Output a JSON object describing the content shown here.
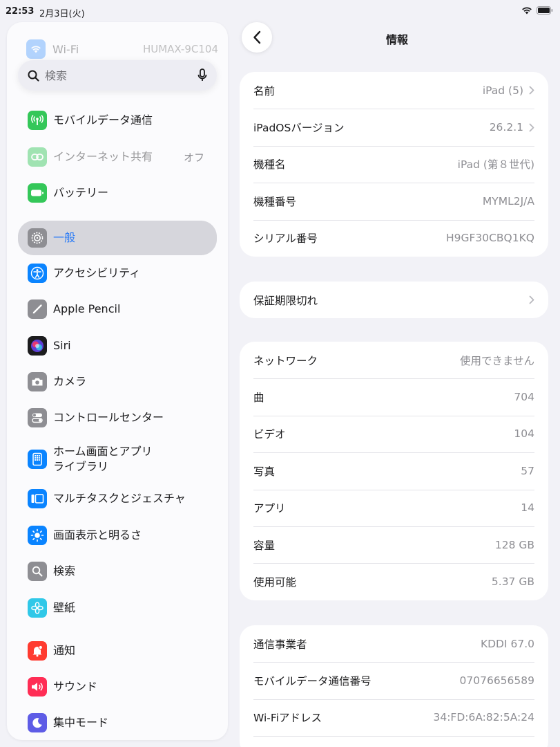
{
  "status_bar": {
    "time": "22:53",
    "date": "2月3日(火)"
  },
  "sidebar": {
    "ghost_wifi": {
      "label": "Wi-Fi",
      "value": "HUMAX-9C104"
    },
    "search": {
      "placeholder": "検索"
    },
    "items": [
      {
        "label": "モバイルデータ通信",
        "icon": "antenna-icon",
        "color": "#34c759"
      },
      {
        "label": "インターネット共有",
        "value": "オフ",
        "icon": "link-icon",
        "color": "#34c759"
      },
      {
        "label": "バッテリー",
        "icon": "battery-icon",
        "color": "#34c759"
      },
      {
        "label": "一般",
        "icon": "gear-icon",
        "color": "#8e8e93"
      },
      {
        "label": "アクセシビリティ",
        "icon": "accessibility-icon",
        "color": "#0a84ff"
      },
      {
        "label": "Apple Pencil",
        "icon": "pencil-icon",
        "color": "#8e8e93"
      },
      {
        "label": "Siri",
        "icon": "siri-icon",
        "color": "#1c1c1e"
      },
      {
        "label": "カメラ",
        "icon": "camera-icon",
        "color": "#8e8e93"
      },
      {
        "label": "コントロールセンター",
        "icon": "toggles-icon",
        "color": "#8e8e93"
      },
      {
        "label_line1": "ホーム画面とアプリ",
        "label_line2": "ライブラリ",
        "icon": "home-grid-icon",
        "color": "#0a84ff"
      },
      {
        "label": "マルチタスクとジェスチャ",
        "icon": "multitask-icon",
        "color": "#0a84ff"
      },
      {
        "label": "画面表示と明るさ",
        "icon": "sun-icon",
        "color": "#0a84ff"
      },
      {
        "label": "検索",
        "icon": "search-icon",
        "color": "#8e8e93"
      },
      {
        "label": "壁紙",
        "icon": "flower-icon",
        "color": "#30c8e8"
      },
      {
        "label": "通知",
        "icon": "bell-icon",
        "color": "#ff3b30"
      },
      {
        "label": "サウンド",
        "icon": "speaker-icon",
        "color": "#ff2d55"
      },
      {
        "label": "集中モード",
        "icon": "moon-icon",
        "color": "#5e5ce6"
      }
    ]
  },
  "main": {
    "title": "情報",
    "group1": [
      {
        "label": "名前",
        "value": "iPad (5)",
        "chevron": true
      },
      {
        "label": "iPadOSバージョン",
        "value": "26.2.1",
        "chevron": true
      },
      {
        "label": "機種名",
        "value": "iPad (第８世代)"
      },
      {
        "label": "機種番号",
        "value": "MYML2J/A"
      },
      {
        "label": "シリアル番号",
        "value": "H9GF30CBQ1KQ"
      }
    ],
    "group2": [
      {
        "label": "保証期限切れ",
        "chevron": true
      }
    ],
    "group3": [
      {
        "label": "ネットワーク",
        "value": "使用できません"
      },
      {
        "label": "曲",
        "value": "704"
      },
      {
        "label": "ビデオ",
        "value": "104"
      },
      {
        "label": "写真",
        "value": "57"
      },
      {
        "label": "アプリ",
        "value": "14"
      },
      {
        "label": "容量",
        "value": "128 GB"
      },
      {
        "label": "使用可能",
        "value": "5.37 GB"
      }
    ],
    "group4": [
      {
        "label": "通信事業者",
        "value": "KDDI 67.0"
      },
      {
        "label": "モバイルデータ通信番号",
        "value": "07076656589"
      },
      {
        "label": "Wi-Fiアドレス",
        "value": "34:FD:6A:82:5A:24"
      }
    ]
  }
}
